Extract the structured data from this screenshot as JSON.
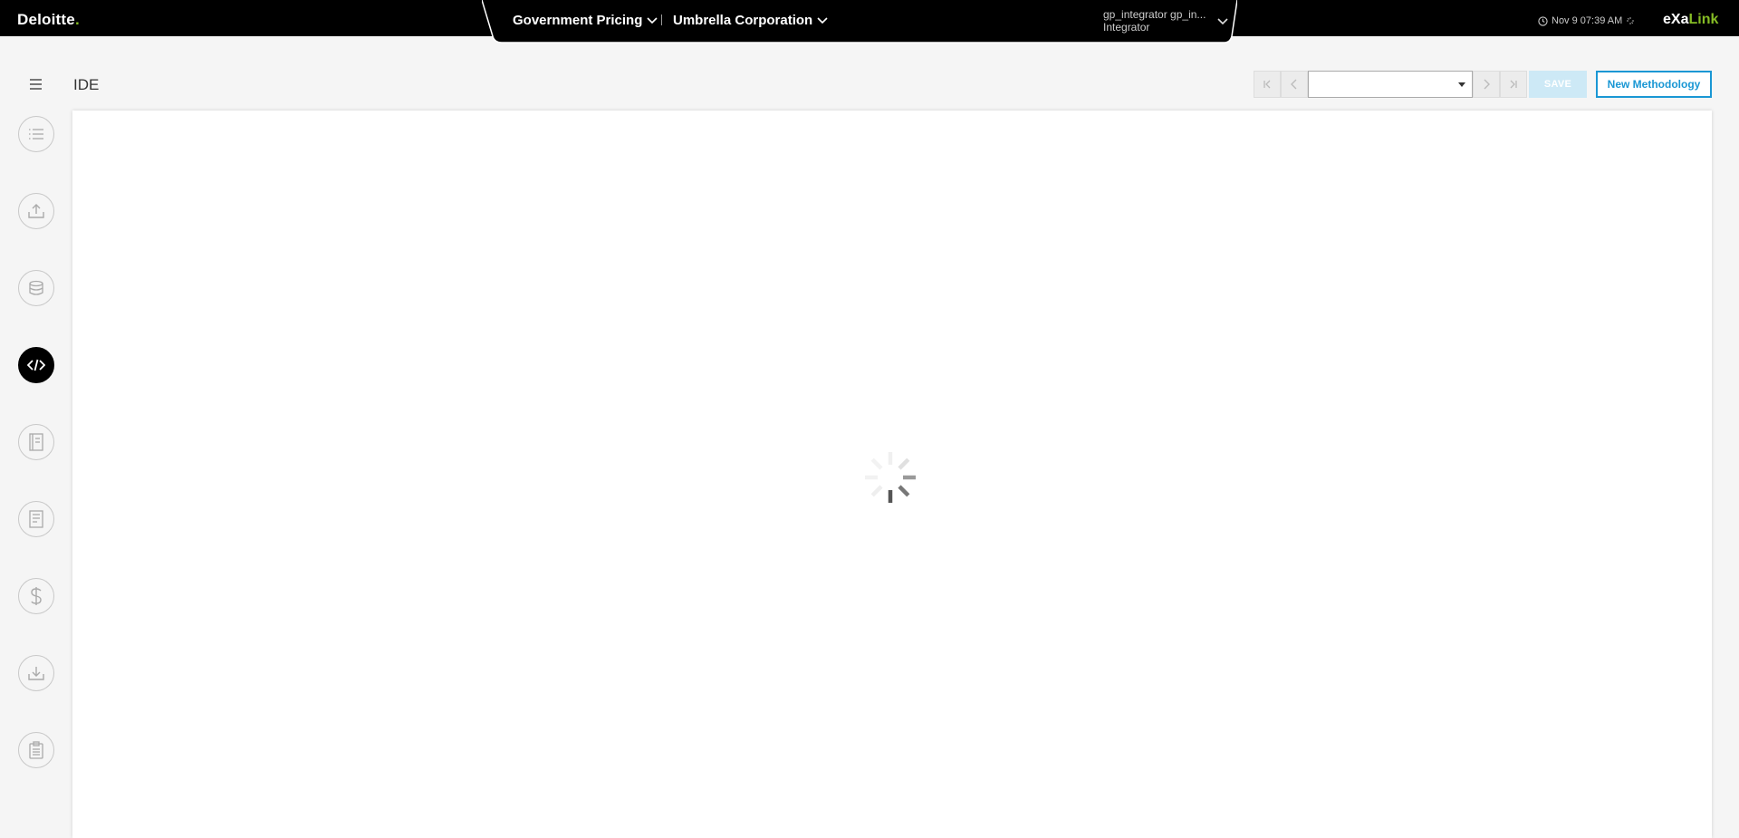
{
  "header": {
    "brand": "Deloitte",
    "brand_dot": ".",
    "context_module": "Government Pricing",
    "context_company": "Umbrella Corporation",
    "user_name": "gp_integrator gp_in...",
    "user_role": "Integrator",
    "datetime": "Nov 9 07:39 AM",
    "app_name_part1": "eXa",
    "app_name_part2": "Link"
  },
  "sidebar": {
    "items": [
      {
        "icon": "list-icon",
        "active": false
      },
      {
        "icon": "upload-icon",
        "active": false
      },
      {
        "icon": "database-icon",
        "active": false
      },
      {
        "icon": "code-icon",
        "active": true
      },
      {
        "icon": "report-icon",
        "active": false
      },
      {
        "icon": "document-icon",
        "active": false
      },
      {
        "icon": "dollar-icon",
        "active": false
      },
      {
        "icon": "download-icon",
        "active": false
      },
      {
        "icon": "clipboard-icon",
        "active": false
      }
    ]
  },
  "page": {
    "title": "IDE",
    "methodology_select_value": "",
    "save_label": "SAVE",
    "new_label": "New Methodology"
  },
  "colors": {
    "brand_green": "#86bc25",
    "accent_blue": "#1a97d4",
    "save_disabled": "#cde9f6"
  },
  "status": {
    "loading": true
  }
}
